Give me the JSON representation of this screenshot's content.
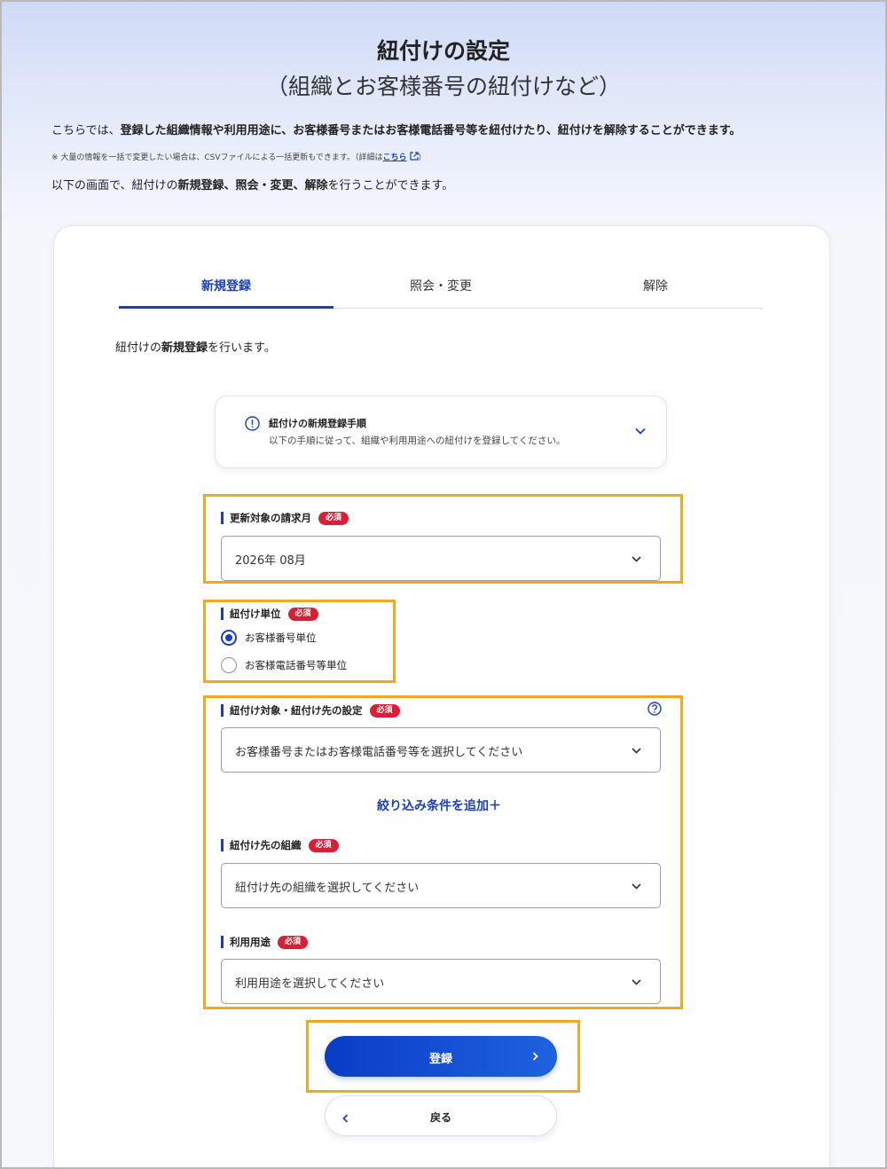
{
  "header": {
    "title": "紐付けの設定",
    "subtitle": "（組織とお客様番号の紐付けなど）"
  },
  "intro": {
    "line1_a": "こちらでは、",
    "line1_b": "登録した組織情報や利用用途に、お客様番号またはお客様電話番号等を紐付けたり、紐付けを解除することができます。",
    "note_a": "※ 大量の情報を一括で変更したい場合は、CSVファイルによる一括更新もできます。（詳細は",
    "note_link": "こちら",
    "note_b": "）",
    "line2_a": "以下の画面で、紐付けの",
    "line2_b": "新規登録、照会・変更、解除",
    "line2_c": "を行うことができます。"
  },
  "tabs": [
    {
      "label": "新規登録"
    },
    {
      "label": "照会・変更"
    },
    {
      "label": "解除"
    }
  ],
  "lead": {
    "a": "紐付けの",
    "b": "新規登録",
    "c": "を行います。"
  },
  "info": {
    "title": "紐付けの新規登録手順",
    "desc": "以下の手順に従って、組織や利用用途への紐付けを登録してください。"
  },
  "required_badge": "必須",
  "billing_month": {
    "label": "更新対象の請求月",
    "value": "2026年 08月"
  },
  "unit": {
    "label": "紐付け単位",
    "options": [
      {
        "label": "お客様番号単位",
        "selected": true
      },
      {
        "label": "お客様電話番号等単位",
        "selected": false
      }
    ]
  },
  "target": {
    "label": "紐付け対象・紐付け先の設定",
    "placeholder": "お客様番号またはお客様電話番号等を選択してください",
    "add_filter": "絞り込み条件を追加＋"
  },
  "org": {
    "label": "紐付け先の組織",
    "placeholder": "紐付け先の組織を選択してください"
  },
  "usage": {
    "label": "利用用途",
    "placeholder": "利用用途を選択してください"
  },
  "buttons": {
    "register": "登録",
    "back": "戻る"
  },
  "colors": {
    "brand": "#1a3fb8",
    "required": "#d91e36",
    "highlight": "#f1a81e"
  }
}
